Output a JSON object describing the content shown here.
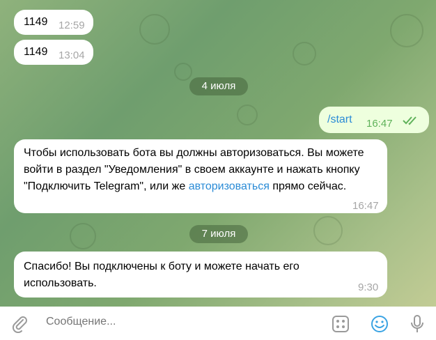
{
  "messages": [
    {
      "text": "1149",
      "time": "12:59"
    },
    {
      "text": "1149",
      "time": "13:04"
    }
  ],
  "date1": "4 июля",
  "outgoing": {
    "text": "/start",
    "time": "16:47"
  },
  "bot_message": {
    "part1": "Чтобы использовать бота вы должны авторизоваться. Вы можете войти в раздел \"Уведомления\" в своем аккаунте и нажать кнопку \"Подключить Telegram\", или же ",
    "link": "авторизоваться",
    "part2": " прямо сейчас.",
    "time": "16:47"
  },
  "date2": "7 июля",
  "bot_message2": {
    "text": "Спасибо! Вы подключены к боту и можете начать его использовать.",
    "time": "9:30"
  },
  "input": {
    "placeholder": "Сообщение..."
  },
  "icons": [
    "attach-icon",
    "commands-icon",
    "emoji-icon",
    "microphone-icon"
  ]
}
